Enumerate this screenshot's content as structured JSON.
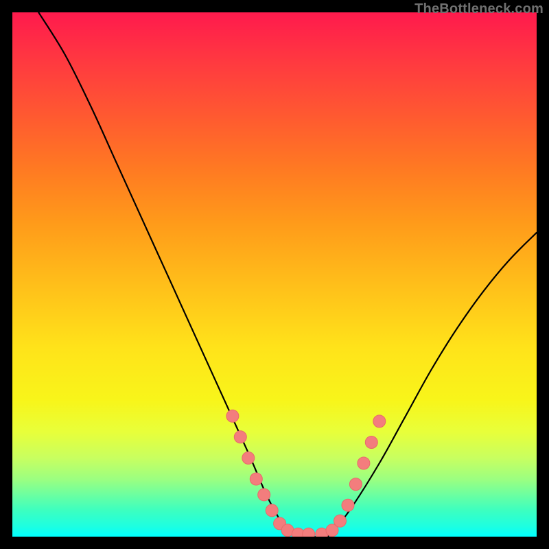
{
  "watermark": "TheBottleneck.com",
  "colors": {
    "background": "#000000",
    "curve": "#000000",
    "marker_fill": "#f37d7d",
    "marker_stroke": "#e86a6a",
    "gradient_top": "#ff1a4d",
    "gradient_bottom": "#00ffff"
  },
  "chart_data": {
    "type": "line",
    "title": "",
    "xlabel": "",
    "ylabel": "",
    "xlim": [
      0,
      100
    ],
    "ylim": [
      0,
      100
    ],
    "grid": false,
    "legend": false,
    "note": "V-shaped bottleneck curve; y-values estimated visually as percent of gradient height (100 = top, 0 = bottom).",
    "series": [
      {
        "name": "curve",
        "x": [
          5,
          10,
          15,
          20,
          25,
          30,
          35,
          40,
          45,
          48,
          50,
          52,
          55,
          57,
          60,
          62,
          65,
          70,
          75,
          80,
          85,
          90,
          95,
          100
        ],
        "y": [
          100,
          92,
          82,
          71,
          60,
          49,
          38,
          27,
          16,
          9,
          5,
          2,
          0,
          0,
          0,
          2,
          6,
          14,
          23,
          32,
          40,
          47,
          53,
          58
        ]
      }
    ],
    "markers": {
      "name": "highlighted-points",
      "note": "Clustered sample dots near curve bottom on both descending and ascending branches.",
      "points": [
        {
          "x": 42,
          "y": 23
        },
        {
          "x": 43.5,
          "y": 19
        },
        {
          "x": 45,
          "y": 15
        },
        {
          "x": 46.5,
          "y": 11
        },
        {
          "x": 48,
          "y": 8
        },
        {
          "x": 49.5,
          "y": 5
        },
        {
          "x": 51,
          "y": 2.5
        },
        {
          "x": 52.5,
          "y": 1.2
        },
        {
          "x": 54.5,
          "y": 0.5
        },
        {
          "x": 56.5,
          "y": 0.5
        },
        {
          "x": 59,
          "y": 0.5
        },
        {
          "x": 61,
          "y": 1.2
        },
        {
          "x": 62.5,
          "y": 3
        },
        {
          "x": 64,
          "y": 6
        },
        {
          "x": 65.5,
          "y": 10
        },
        {
          "x": 67,
          "y": 14
        },
        {
          "x": 68.5,
          "y": 18
        },
        {
          "x": 70,
          "y": 22
        }
      ]
    }
  }
}
